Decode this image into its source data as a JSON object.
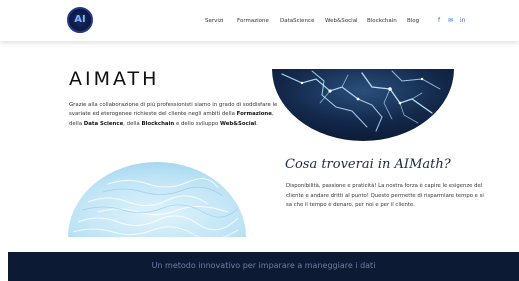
{
  "brand": {
    "logo_mark": "AI",
    "colors": {
      "navy": "#0c1a34",
      "accent": "#2a6bd6",
      "sky": "#bfe4f6"
    }
  },
  "nav": {
    "items": [
      "Servizi",
      "Formazione",
      "DataScience",
      "Web&Social",
      "Blockchain",
      "Blog"
    ],
    "social": [
      "f",
      "✉",
      "in"
    ],
    "social_icons": [
      "facebook-icon",
      "mail-icon",
      "linkedin-icon"
    ]
  },
  "hero": {
    "title": "AIMATH",
    "intro": {
      "p1": "Grazie alla collaborazione di più professionisti siamo in grado di soddisfare le svariate ed eterogenee richieste del cliente negli ambiti della ",
      "b1": "Formazione",
      "p2": ", della ",
      "b2": "Data Science",
      "p3": ", della ",
      "b3": "Blockchain",
      "p4": " e dello sviluppo ",
      "b4": "Web&Social",
      "p5": "."
    }
  },
  "features": {
    "title": "Cosa troverai in AIMath?",
    "body": "Disponibilità, passione e praticità! La nostra forza è capire le esigenze del cliente e andare dritti al punto! Questo permette di risparmiare tempo e si sa che il tempo è denaro, per noi e per il cliente."
  },
  "footer": {
    "tagline": "Un metodo innovativo per imparare a maneggiare i dati"
  }
}
